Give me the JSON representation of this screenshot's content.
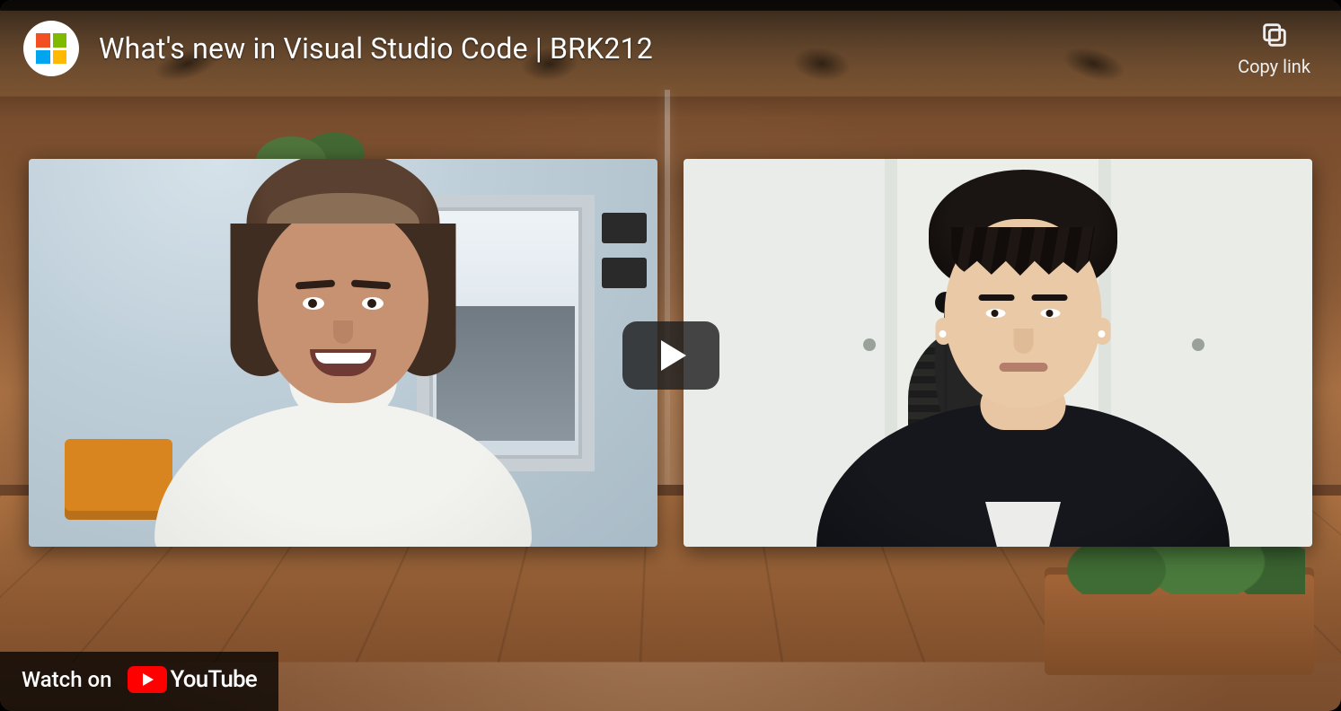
{
  "video": {
    "title": "What's new in Visual Studio Code | BRK212",
    "channel_icon": "microsoft-logo"
  },
  "controls": {
    "copy_link_label": "Copy link",
    "watch_on_label": "Watch on",
    "youtube_wordmark": "YouTube"
  }
}
